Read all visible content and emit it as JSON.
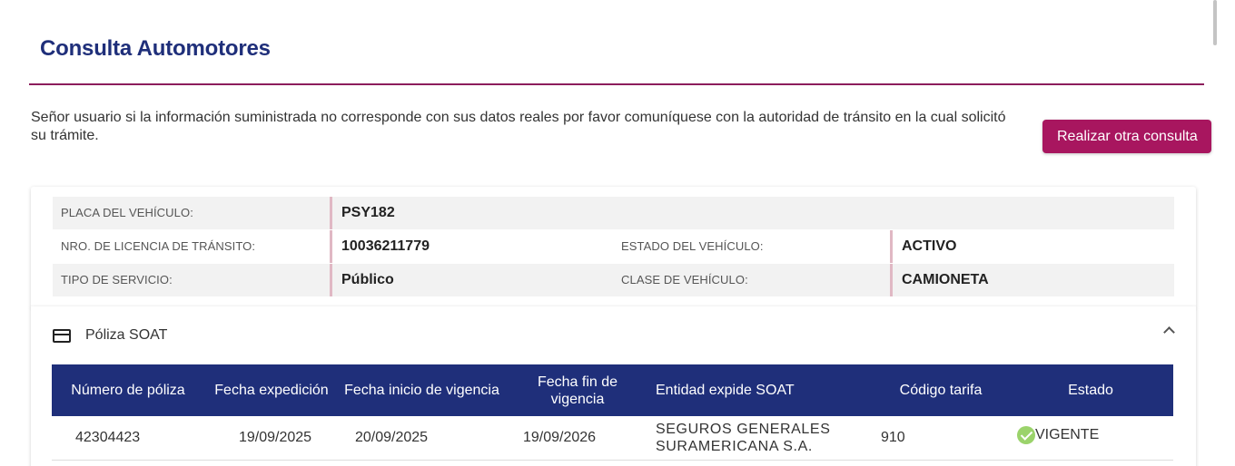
{
  "page": {
    "title": "Consulta Automotores"
  },
  "notice": {
    "text": "Señor usuario si la información suministrada no corresponde con sus datos reales por favor comuníquese con la autoridad de tránsito en la cual solicitó su trámite."
  },
  "actions": {
    "new_query_label": "Realizar otra consulta"
  },
  "vehicle": {
    "plate_label": "PLACA DEL VEHÍCULO:",
    "plate_value": "PSY182",
    "license_label": "NRO. DE LICENCIA DE TRÁNSITO:",
    "license_value": "10036211779",
    "state_label": "ESTADO DEL VEHÍCULO:",
    "state_value": "ACTIVO",
    "service_label": "TIPO DE SERVICIO:",
    "service_value": "Público",
    "class_label": "CLASE DE VEHÍCULO:",
    "class_value": "CAMIONETA"
  },
  "soat": {
    "title": "Póliza SOAT",
    "icon": "credit-card-icon",
    "expanded": true,
    "columns": [
      "Número de póliza",
      "Fecha expedición",
      "Fecha inicio de vigencia",
      "Fecha fin de vigencia",
      "Entidad expide SOAT",
      "Código tarifa",
      "Estado"
    ],
    "rows": [
      {
        "policy": "42304423",
        "issued": "19/09/2025",
        "start": "20/09/2025",
        "end": "19/09/2026",
        "entity": "SEGUROS GENERALES SURAMERICANA S.A.",
        "rate_code": "910",
        "status": "VIGENTE"
      }
    ]
  },
  "colors": {
    "title": "#1f2f7a",
    "accent": "#a8165f",
    "table_header": "#1f2f7a",
    "status_ok": "#9bd36b"
  }
}
